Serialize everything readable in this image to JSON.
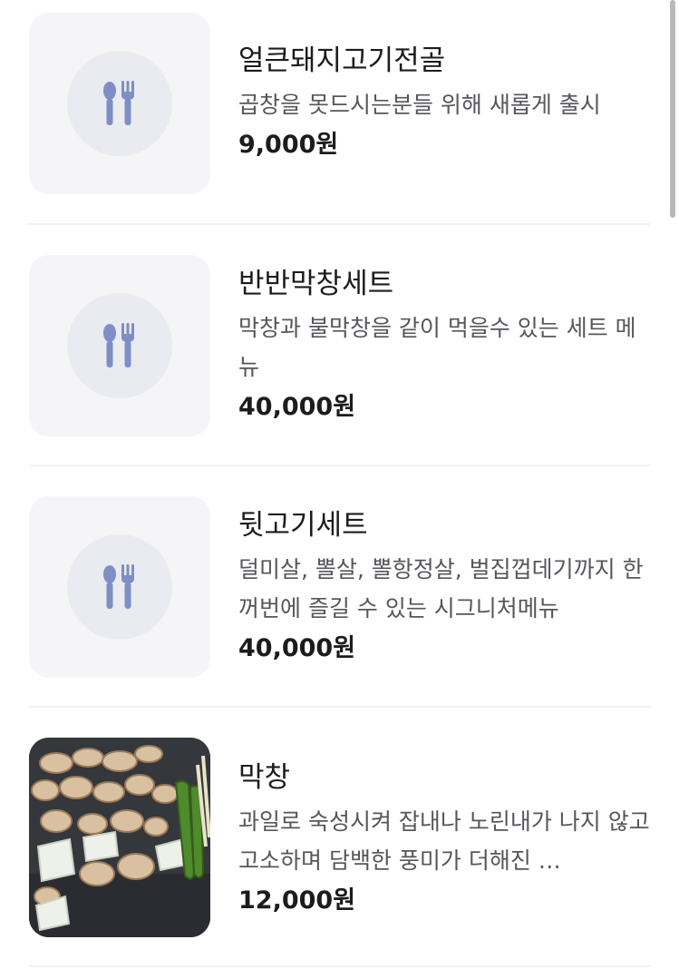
{
  "menu": {
    "items": [
      {
        "name": "얼큰돼지고기전골",
        "description": "곱창을 못드시는분들 위해 새롭게 출시",
        "price": "9,000원",
        "image": "utensils-placeholder-icon"
      },
      {
        "name": "반반막창세트",
        "description": "막창과 불막창을 같이 먹을수 있는 세트 메뉴",
        "price": "40,000원",
        "image": "utensils-placeholder-icon"
      },
      {
        "name": "뒷고기세트",
        "description": "덜미살, 뽈살, 뽈항정살, 벌집껍데기까지 한꺼번에 즐길 수 있는 시그니처메뉴",
        "price": "40,000원",
        "image": "utensils-placeholder-icon"
      },
      {
        "name": "막창",
        "description": "과일로 숙성시켜 잡내나 노린내가 나지 않고 고소하며 담백한 풍미가 더해진 …",
        "price": "12,000원",
        "image": "grilled-makchang-photo"
      }
    ]
  },
  "colors": {
    "placeholder_bg": "#f5f5f7",
    "placeholder_circle": "#e9ebf1",
    "icon_blue": "#7d8fc4",
    "divider": "#f1f1f3",
    "description_text": "#56565c"
  }
}
